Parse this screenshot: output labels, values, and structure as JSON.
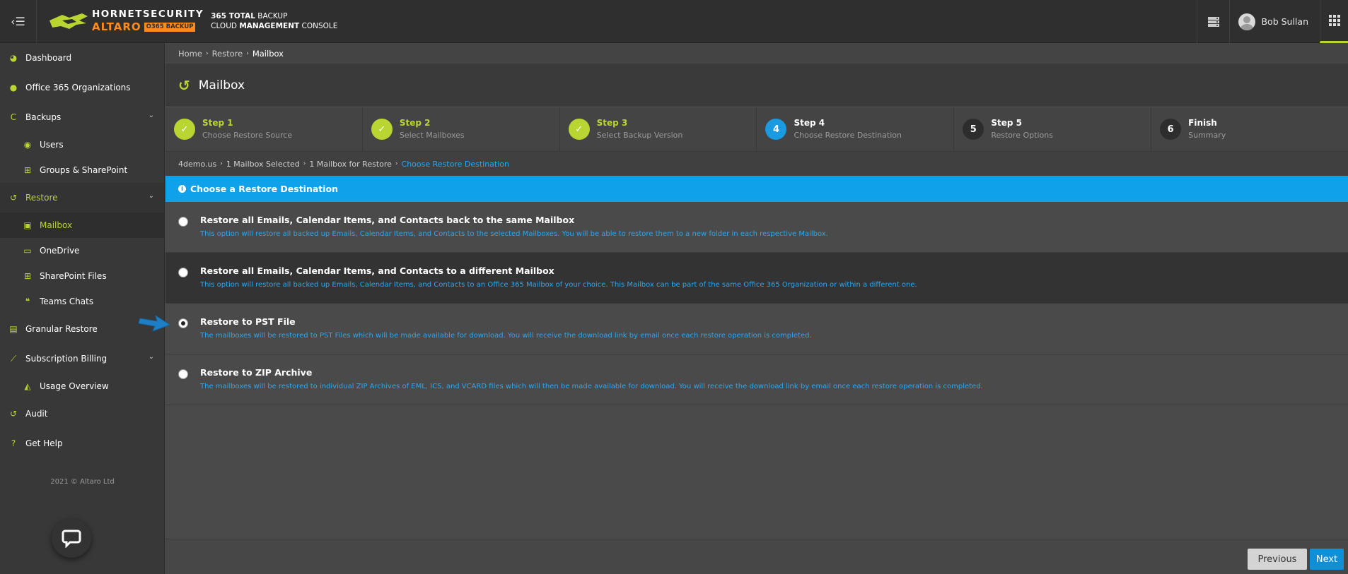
{
  "header": {
    "brand_top": "HORNETSECURITY",
    "brand_altaro": "ALTARO",
    "brand_badge": "O365 BACKUP",
    "console_line1_bold": "365 TOTAL",
    "console_line1": "BACKUP",
    "console_line2_a": "CLOUD",
    "console_line2_bold": "MANAGEMENT",
    "console_line2_b": "CONSOLE",
    "user_name": "Bob Sullan",
    "accent": "#b9d532"
  },
  "sidebar": {
    "items": [
      {
        "label": "Dashboard"
      },
      {
        "label": "Office 365 Organizations"
      },
      {
        "label": "Backups"
      },
      {
        "label": "Users"
      },
      {
        "label": "Groups & SharePoint"
      },
      {
        "label": "Restore"
      },
      {
        "label": "Mailbox"
      },
      {
        "label": "OneDrive"
      },
      {
        "label": "SharePoint Files"
      },
      {
        "label": "Teams Chats"
      },
      {
        "label": "Granular Restore"
      },
      {
        "label": "Subscription Billing"
      },
      {
        "label": "Usage Overview"
      },
      {
        "label": "Audit"
      },
      {
        "label": "Get Help"
      }
    ],
    "copyright": "2021 © Altaro Ltd"
  },
  "breadcrumb": [
    "Home",
    "Restore",
    "Mailbox"
  ],
  "page_title": "Mailbox",
  "steps": [
    {
      "name": "Step 1",
      "sub": "Choose Restore Source",
      "state": "done"
    },
    {
      "name": "Step 2",
      "sub": "Select Mailboxes",
      "state": "done"
    },
    {
      "name": "Step 3",
      "sub": "Select Backup Version",
      "state": "done"
    },
    {
      "name": "Step 4",
      "sub": "Choose Restore Destination",
      "state": "current",
      "num": "4"
    },
    {
      "name": "Step 5",
      "sub": "Restore Options",
      "state": "todo",
      "num": "5"
    },
    {
      "name": "Finish",
      "sub": "Summary",
      "state": "todo",
      "num": "6"
    }
  ],
  "selection": [
    "4demo.us",
    "1 Mailbox Selected",
    "1 Mailbox for Restore",
    "Choose Restore Destination"
  ],
  "section_title": "Choose a Restore Destination",
  "options": [
    {
      "title": "Restore all Emails, Calendar Items, and Contacts back to the same Mailbox",
      "desc": "This option will restore all backed up Emails, Calendar Items, and Contacts to the selected Mailboxes. You will be able to restore them to a new folder in each respective Mailbox."
    },
    {
      "title": "Restore all Emails, Calendar Items, and Contacts to a different Mailbox",
      "desc": "This option will restore all backed up Emails, Calendar Items, and Contacts to an Office 365 Mailbox of your choice. This Mailbox can be part of the same Office 365 Organization or within a different one."
    },
    {
      "title": "Restore to PST File",
      "desc": "The mailboxes will be restored to PST Files which will be made available for download. You will receive the download link by email once each restore operation is completed."
    },
    {
      "title": "Restore to ZIP Archive",
      "desc": "The mailboxes will be restored to individual ZIP Archives of EML, ICS, and VCARD files which will then be made available for download. You will receive the download link by email once each restore operation is completed."
    }
  ],
  "buttons": {
    "previous": "Previous",
    "next": "Next"
  },
  "colors": {
    "accent_green": "#b9d532",
    "accent_blue": "#0fa2ea",
    "link_blue": "#29a8f0"
  }
}
